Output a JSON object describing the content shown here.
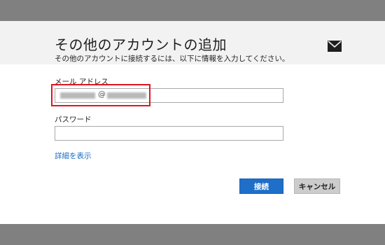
{
  "dialog": {
    "title": "その他のアカウントの追加",
    "header_icon": "mail-icon",
    "instruction": "その他のアカウントに接続するには、以下に情報を入力してください。",
    "email": {
      "label": "メール アドレス",
      "value_visible_separator": "@"
    },
    "password": {
      "label": "パスワード",
      "value": ""
    },
    "details_link": "詳細を表示",
    "buttons": {
      "connect": "接続",
      "cancel": "キャンセル"
    }
  },
  "colors": {
    "accent": "#1e6fc8",
    "link": "#1a6dc4",
    "highlight": "#e0141e",
    "backdrop": "#808080"
  }
}
